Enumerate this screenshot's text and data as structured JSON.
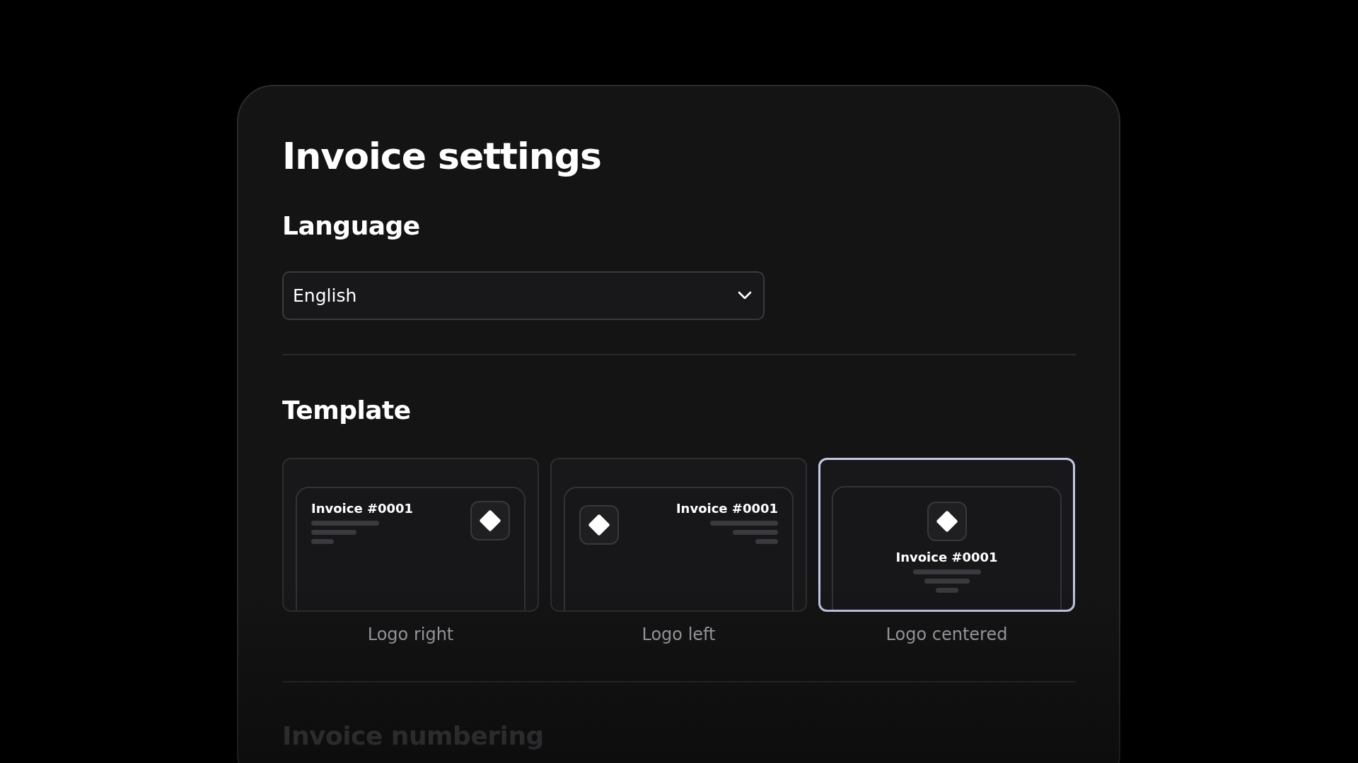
{
  "title": "Invoice settings",
  "language": {
    "heading": "Language",
    "value": "English"
  },
  "template": {
    "heading": "Template",
    "options": [
      {
        "kind": "logo-right",
        "label": "Logo right",
        "invoice": "Invoice #0001",
        "selected": false
      },
      {
        "kind": "logo-left",
        "label": "Logo left",
        "invoice": "Invoice #0001",
        "selected": false
      },
      {
        "kind": "logo-centered",
        "label": "Logo centered",
        "invoice": "Invoice #0001",
        "selected": true
      }
    ]
  },
  "numbering": {
    "heading": "Invoice numbering"
  }
}
